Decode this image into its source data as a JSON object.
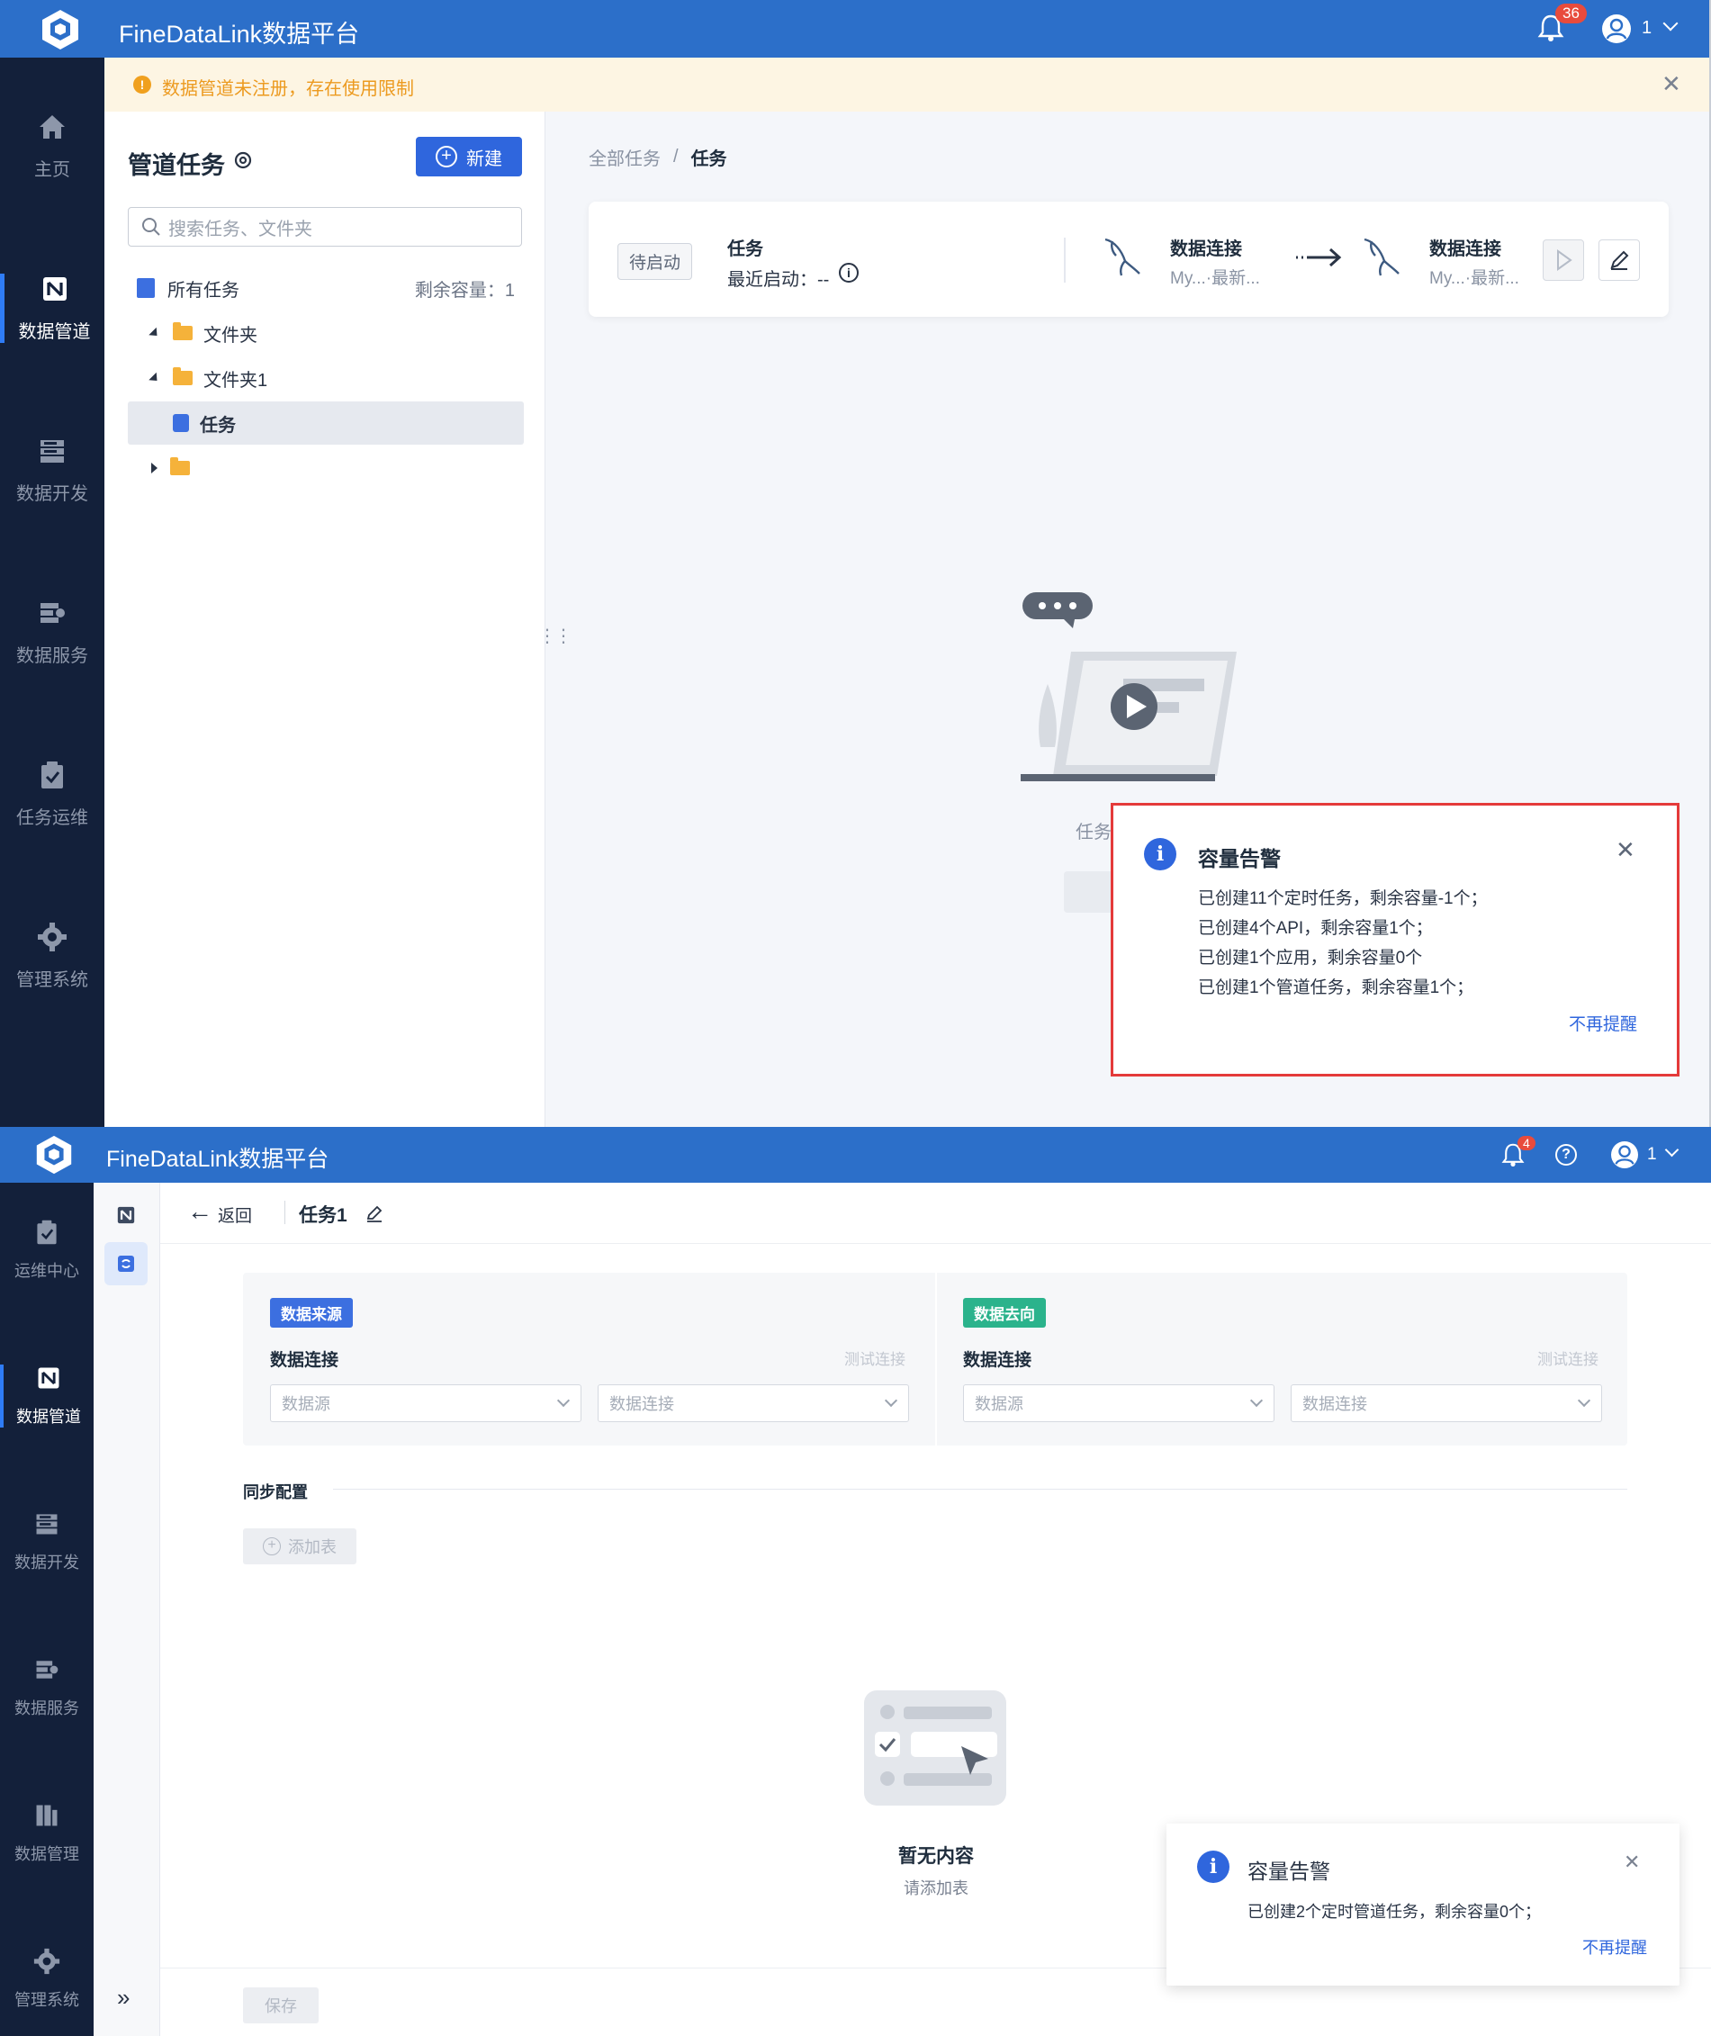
{
  "screen1": {
    "app_title": "FineDataLink数据平台",
    "notification_count": "36",
    "user": "1",
    "banner": "数据管道未注册，存在使用限制",
    "nav": [
      {
        "label": "主页",
        "icon": "home-icon"
      },
      {
        "label": "数据管道",
        "icon": "pipeline-icon"
      },
      {
        "label": "数据开发",
        "icon": "dev-icon"
      },
      {
        "label": "数据服务",
        "icon": "service-icon"
      },
      {
        "label": "任务运维",
        "icon": "ops-icon"
      },
      {
        "label": "管理系统",
        "icon": "gear-icon"
      }
    ],
    "panel": {
      "title": "管道任务",
      "new_button": "新建",
      "search_placeholder": "搜索任务、文件夹",
      "all_tasks": "所有任务",
      "capacity": "剩余容量：1",
      "tree": [
        "文件夹",
        "文件夹1",
        "任务"
      ]
    },
    "breadcrumb": {
      "root": "全部任务",
      "sep": "/",
      "current": "任务"
    },
    "task_card": {
      "status": "待启动",
      "name": "任务",
      "last_start": "最近启动：--",
      "source_title": "数据连接",
      "source_sub": "My...·最新...",
      "target_title": "数据连接",
      "target_sub": "My...·最新..."
    },
    "empty_label": "任务",
    "alert": {
      "title": "容量告警",
      "lines": [
        "已创建11个定时任务，剩余容量-1个；",
        "已创建4个API，剩余容量1个；",
        "已创建1个应用，剩余容量0个",
        "已创建1个管道任务，剩余容量1个；"
      ],
      "dismiss": "不再提醒"
    }
  },
  "screen2": {
    "app_title": "FineDataLink数据平台",
    "notification_count": "4",
    "user": "1",
    "nav": [
      {
        "label": "运维中心",
        "icon": "ops-icon"
      },
      {
        "label": "数据管道",
        "icon": "pipeline-icon"
      },
      {
        "label": "数据开发",
        "icon": "dev-icon"
      },
      {
        "label": "数据服务",
        "icon": "service-icon"
      },
      {
        "label": "数据管理",
        "icon": "manage-icon"
      },
      {
        "label": "管理系统",
        "icon": "gear-icon"
      }
    ],
    "header": {
      "back": "返回",
      "task_name": "任务1"
    },
    "source": {
      "tag": "数据来源",
      "conn_label": "数据连接",
      "test": "测试连接",
      "select1": "数据源",
      "select2": "数据连接"
    },
    "target": {
      "tag": "数据去向",
      "conn_label": "数据连接",
      "test": "测试连接",
      "select1": "数据源",
      "select2": "数据连接"
    },
    "sync_title": "同步配置",
    "add_table": "添加表",
    "empty_title": "暂无内容",
    "empty_sub": "请添加表",
    "save": "保存",
    "alert": {
      "title": "容量告警",
      "line": "已创建2个定时管道任务，剩余容量0个；",
      "dismiss": "不再提醒"
    }
  }
}
